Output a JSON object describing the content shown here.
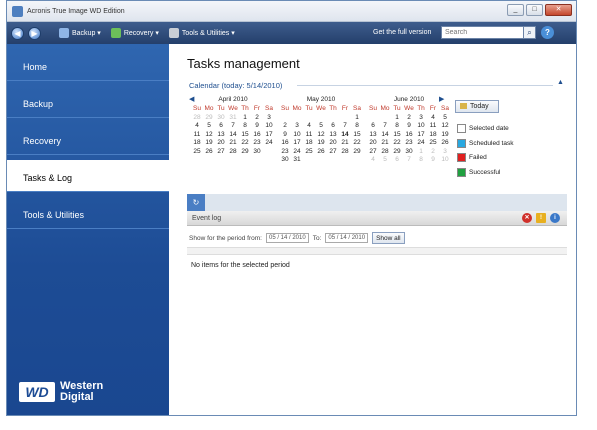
{
  "window": {
    "title": "Acronis True Image WD Edition",
    "buttons": {
      "min": "_",
      "max": "□",
      "close": "✕"
    }
  },
  "toolbar": {
    "back": "◀",
    "forward": "▶",
    "items": [
      {
        "label": "Backup ▾"
      },
      {
        "label": "Recovery ▾"
      },
      {
        "label": "Tools & Utilities ▾"
      }
    ],
    "get_full": "Get the full version",
    "search_placeholder": "Search",
    "search_icon": "⌕",
    "help": "?"
  },
  "sidebar": {
    "items": [
      {
        "label": "Home"
      },
      {
        "label": "Backup"
      },
      {
        "label": "Recovery"
      },
      {
        "label": "Tasks & Log",
        "active": true
      },
      {
        "label": "Tools & Utilities"
      }
    ],
    "logo_mark": "WD",
    "logo_line1": "Western",
    "logo_line2": "Digital"
  },
  "main": {
    "title": "Tasks management",
    "calendar_header": "Calendar (today: 5/14/2010)",
    "collapse_icon": "▲",
    "prev": "◀",
    "next": "▶",
    "weekdays": [
      "Su",
      "Mo",
      "Tu",
      "We",
      "Th",
      "Fr",
      "Sa"
    ],
    "months": [
      {
        "name": "April 2010",
        "rows": [
          [
            "28",
            "29",
            "30",
            "31",
            "1",
            "2",
            "3"
          ],
          [
            "4",
            "5",
            "6",
            "7",
            "8",
            "9",
            "10"
          ],
          [
            "11",
            "12",
            "13",
            "14",
            "15",
            "16",
            "17"
          ],
          [
            "18",
            "19",
            "20",
            "21",
            "22",
            "23",
            "24"
          ],
          [
            "25",
            "26",
            "27",
            "28",
            "29",
            "30",
            ""
          ]
        ],
        "other": [
          0,
          1,
          2,
          3
        ]
      },
      {
        "name": "May 2010",
        "rows": [
          [
            "",
            "",
            "",
            "",
            "",
            "",
            "1"
          ],
          [
            "2",
            "3",
            "4",
            "5",
            "6",
            "7",
            "8"
          ],
          [
            "9",
            "10",
            "11",
            "12",
            "13",
            "14",
            "15"
          ],
          [
            "16",
            "17",
            "18",
            "19",
            "20",
            "21",
            "22"
          ],
          [
            "23",
            "24",
            "25",
            "26",
            "27",
            "28",
            "29"
          ],
          [
            "30",
            "31",
            "",
            "",
            "",
            "",
            ""
          ]
        ],
        "other": []
      },
      {
        "name": "June 2010",
        "rows": [
          [
            "",
            "",
            "1",
            "2",
            "3",
            "4",
            "5"
          ],
          [
            "6",
            "7",
            "8",
            "9",
            "10",
            "11",
            "12"
          ],
          [
            "13",
            "14",
            "15",
            "16",
            "17",
            "18",
            "19"
          ],
          [
            "20",
            "21",
            "22",
            "23",
            "24",
            "25",
            "26"
          ],
          [
            "27",
            "28",
            "29",
            "30",
            "1",
            "2",
            "3"
          ],
          [
            "4",
            "5",
            "6",
            "7",
            "8",
            "9",
            "10"
          ]
        ],
        "other": []
      }
    ],
    "today_label": "Today",
    "legend": [
      {
        "label": "Selected date",
        "color": "#ffffff"
      },
      {
        "label": "Scheduled task",
        "color": "#29a8e0"
      },
      {
        "label": "Failed",
        "color": "#e02020"
      },
      {
        "label": "Successful",
        "color": "#20a040"
      }
    ],
    "event_tab": "↻",
    "event_log": "Event log",
    "event_icons": {
      "error": "✕",
      "warning": "!",
      "info": "i"
    },
    "filter_label": "Show for the period from:",
    "from": "05 / 14 / 2010",
    "to_label": "To:",
    "to": "05 / 14 / 2010",
    "show_all": "Show all",
    "no_items": "No items for the selected period"
  }
}
